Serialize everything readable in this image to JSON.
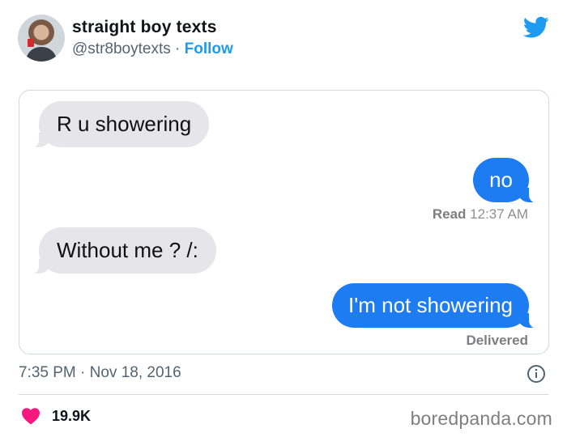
{
  "header": {
    "display_name": "straight boy texts",
    "handle": "@str8boytexts",
    "separator": "·",
    "follow_label": "Follow"
  },
  "conversation": {
    "messages": [
      {
        "direction": "incoming",
        "text": "R u showering"
      },
      {
        "direction": "outgoing",
        "text": "no"
      },
      {
        "direction": "incoming",
        "text": "Without me ? /:"
      },
      {
        "direction": "outgoing",
        "text": "I'm not showering"
      }
    ],
    "read_label": "Read",
    "read_time": "12:37 AM",
    "delivered_label": "Delivered"
  },
  "footer": {
    "timestamp": "7:35 PM · Nov 18, 2016",
    "like_count": "19.9K",
    "watermark": "boredpanda.com"
  },
  "colors": {
    "twitter_blue": "#1d9bf0",
    "imessage_blue": "#1e7cf2",
    "incoming_gray": "#e5e5ea",
    "heart_pink": "#f91880"
  },
  "icons": [
    "avatar",
    "twitter-bird-icon",
    "info-icon",
    "heart-icon"
  ]
}
